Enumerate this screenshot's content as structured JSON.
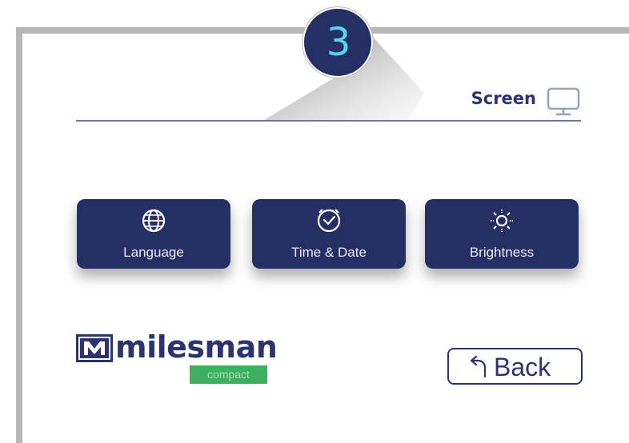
{
  "step": {
    "number": "3"
  },
  "header": {
    "title": "Screen",
    "icon": "monitor-icon"
  },
  "settings_tiles": [
    {
      "label": "Language",
      "icon": "globe-icon"
    },
    {
      "label": "Time & Date",
      "icon": "clock-icon"
    },
    {
      "label": "Brightness",
      "icon": "sun-icon"
    }
  ],
  "logo": {
    "word": "milesman",
    "subtitle": "compact"
  },
  "back_button": {
    "label": "Back",
    "icon": "back-arrow-icon"
  },
  "colors": {
    "navy": "#252f63",
    "accent_cyan": "#55d6f2",
    "frame_gray": "#b7b7b7",
    "logo_green": "#3eaf5f"
  }
}
